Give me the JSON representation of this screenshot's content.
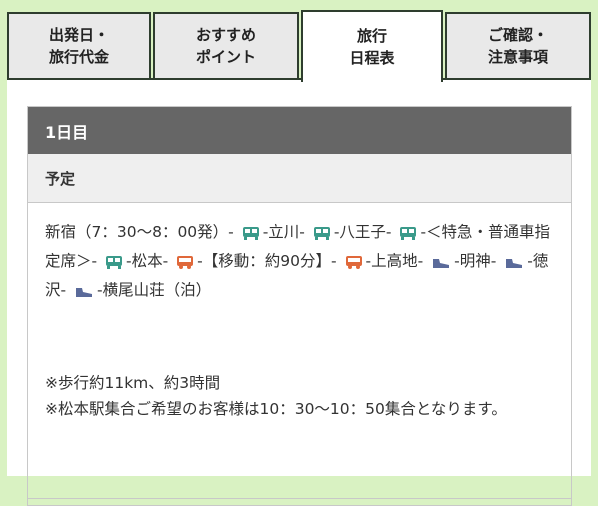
{
  "tabs": [
    {
      "label": "出発日・\n旅行代金"
    },
    {
      "label": "おすすめ\nポイント"
    },
    {
      "label": "旅行\n日程表"
    },
    {
      "label": "ご確認・\n注意事項"
    }
  ],
  "day": {
    "title": "1日目",
    "plan_label": "予定",
    "itinerary": {
      "seg1": "新宿（7：30～8：00発）-",
      "seg2": "-立川-",
      "seg3": "-八王子-",
      "seg4": "-＜特急・普通車指定席＞-",
      "seg5": "-松本-",
      "seg6": "-【移動：約90分】-",
      "seg7": "-上高地-",
      "seg8": "-明神-",
      "seg9": "-徳沢-",
      "seg10": "-横尾山荘（泊）"
    },
    "notes": [
      "※歩行約11km、約3時間",
      "※松本駅集合ご希望のお客様は10：30～10：50集合となります。"
    ]
  },
  "icons": {
    "train": "train-icon",
    "bus": "bus-icon",
    "walk": "walk-shoe-icon",
    "train_color": "#3a9a8a",
    "bus_color": "#e0683a",
    "shoe_color": "#5a6a9a"
  }
}
